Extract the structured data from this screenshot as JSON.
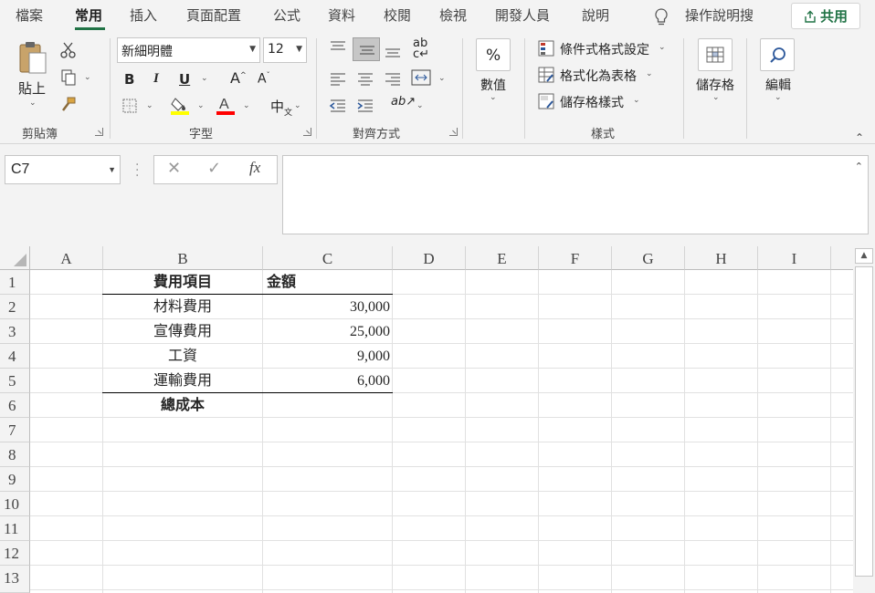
{
  "tabs": [
    "檔案",
    "常用",
    "插入",
    "頁面配置",
    "公式",
    "資料",
    "校閱",
    "檢視",
    "開發人員",
    "說明"
  ],
  "active_tab": "常用",
  "tell_me": "操作說明搜",
  "share_label": "共用",
  "accent_color": "#217346",
  "ribbon": {
    "clipboard": {
      "paste_label": "貼上",
      "group_label": "剪貼簿"
    },
    "font": {
      "font_name": "新細明體",
      "font_size": "12",
      "group_label": "字型",
      "phonetic_label": "中"
    },
    "alignment": {
      "group_label": "對齊方式"
    },
    "number": {
      "label": "數值"
    },
    "styles": {
      "conditional_label": "條件式格式設定",
      "table_label": "格式化為表格",
      "cell_styles_label": "儲存格樣式",
      "group_label": "樣式"
    },
    "cells": {
      "label": "儲存格"
    },
    "editing": {
      "label": "編輯"
    }
  },
  "formula_bar": {
    "name_box": "C7",
    "fx_label": "fx",
    "formula": ""
  },
  "sheet": {
    "columns": [
      "A",
      "B",
      "C",
      "D",
      "E",
      "F",
      "G",
      "H",
      "I"
    ],
    "rows": [
      "1",
      "2",
      "3",
      "4",
      "5",
      "6",
      "7",
      "8",
      "9",
      "10",
      "11",
      "12",
      "13"
    ],
    "cells": {
      "B1": "費用項目",
      "C1": "金額",
      "B2": "材料費用",
      "C2": "30,000",
      "B3": "宣傳費用",
      "C3": "25,000",
      "B4": "工資",
      "C4": "9,000",
      "B5": "運輸費用",
      "C5": "6,000",
      "B6": "總成本"
    }
  }
}
